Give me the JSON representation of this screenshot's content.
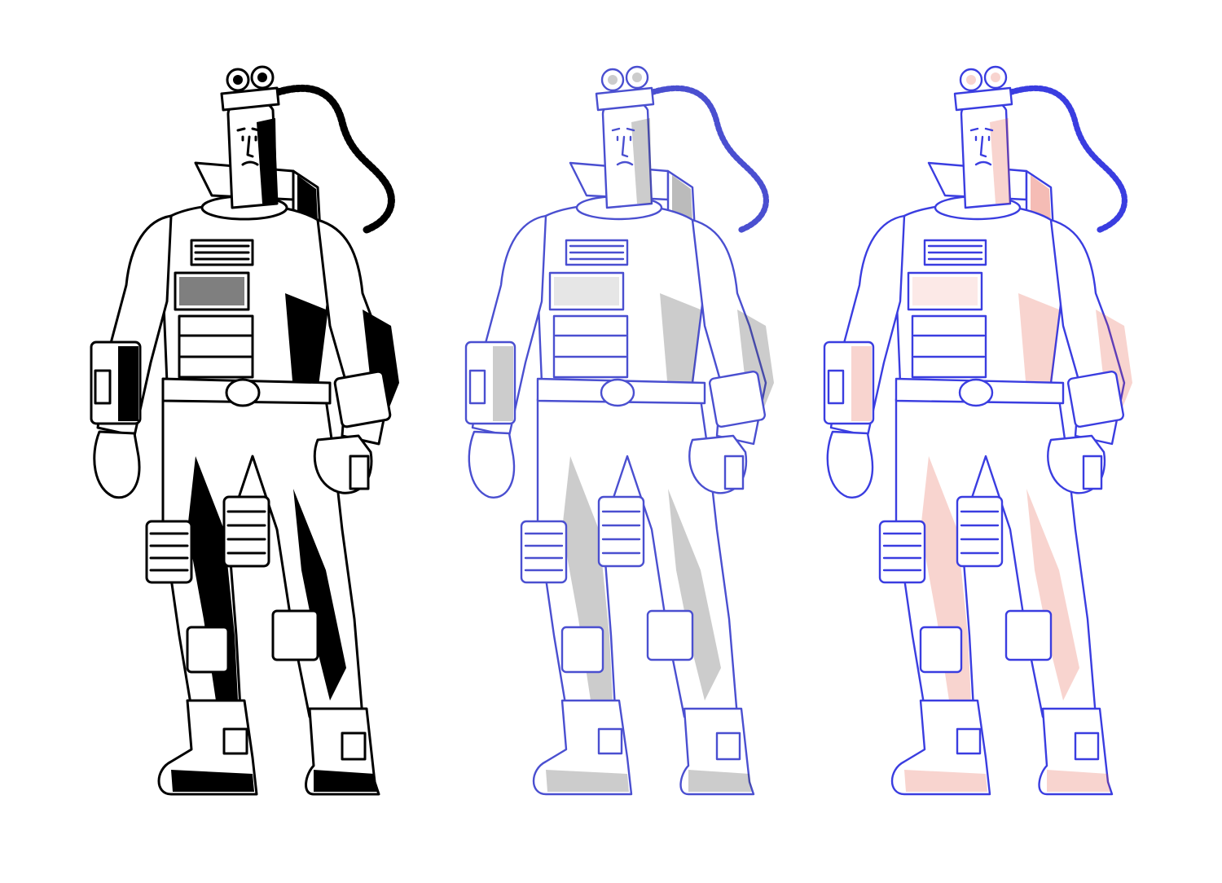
{
  "artwork": {
    "stages": [
      {
        "id": "ink",
        "stroke": "#000000",
        "fill": "#000000",
        "shade": "#000000",
        "opacity": 1
      },
      {
        "id": "graphite",
        "stroke": "#4a4fd0",
        "fill": "#5a5a5a",
        "shade": "#3c3c3c",
        "opacity": 0.75
      },
      {
        "id": "rough",
        "stroke": "#3a3de0",
        "fill": "#f2e25a",
        "shade": "#e2402a",
        "opacity": 0.65
      }
    ]
  }
}
